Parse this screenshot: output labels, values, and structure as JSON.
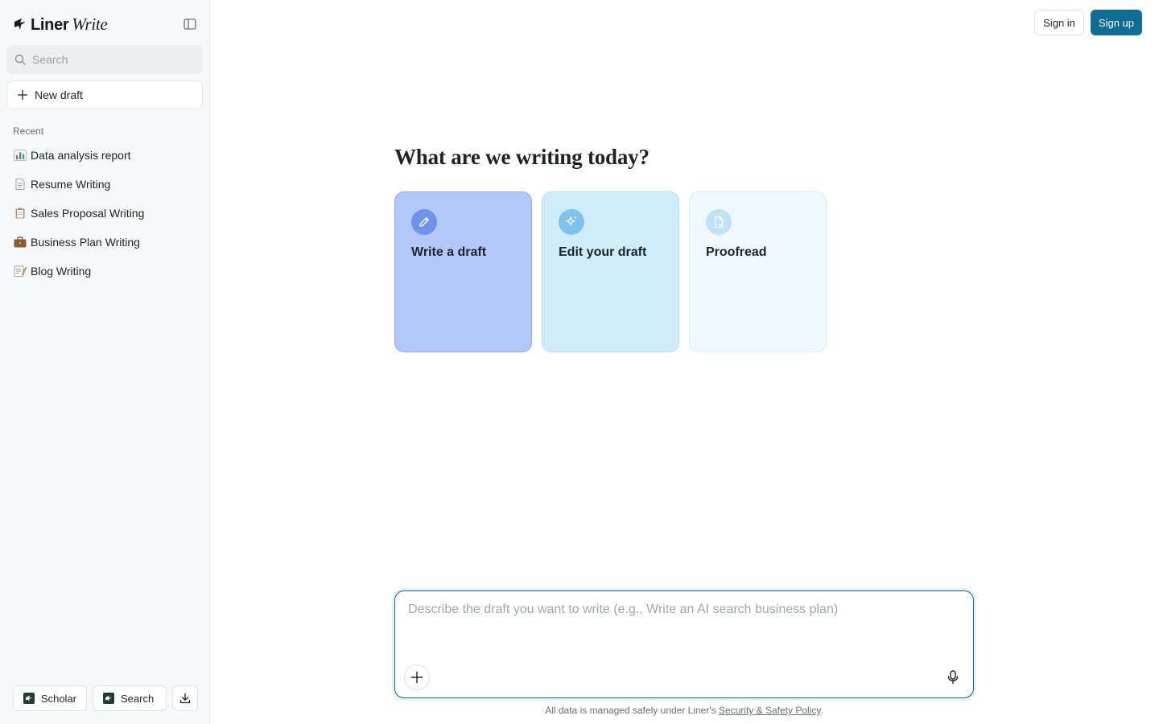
{
  "brand": {
    "name": "Liner",
    "product": "Write"
  },
  "sidebar": {
    "search_placeholder": "Search",
    "new_draft_label": "New draft",
    "recent_label": "Recent",
    "recent_items": [
      {
        "emoji": "bar-chart-emoji",
        "label": "Data analysis report"
      },
      {
        "emoji": "page-emoji",
        "label": "Resume Writing"
      },
      {
        "emoji": "clipboard-emoji",
        "label": "Sales Proposal Writing"
      },
      {
        "emoji": "briefcase-emoji",
        "label": "Business Plan Writing"
      },
      {
        "emoji": "memo-emoji",
        "label": "Blog Writing"
      }
    ],
    "bottom": {
      "scholar_label": "Scholar",
      "search_label": "Search"
    }
  },
  "header": {
    "signin_label": "Sign in",
    "signup_label": "Sign up"
  },
  "main": {
    "headline": "What are we writing today?",
    "cards": [
      {
        "label": "Write a draft",
        "icon": "pencil-icon"
      },
      {
        "label": "Edit your draft",
        "icon": "sparkle-icon"
      },
      {
        "label": "Proofread",
        "icon": "document-check-icon"
      }
    ],
    "composer": {
      "placeholder": "Describe the draft you want to write (e.g., Write an AI search business plan)",
      "value": ""
    },
    "footer_prefix": "All data is managed safely under Liner's ",
    "footer_link": "Security & Safety Policy",
    "footer_suffix": "."
  },
  "colors": {
    "accent": "#0e6c95",
    "card_write": "#b3c7fa",
    "card_edit": "#cfecfd",
    "card_proofread": "#eef8fe"
  }
}
